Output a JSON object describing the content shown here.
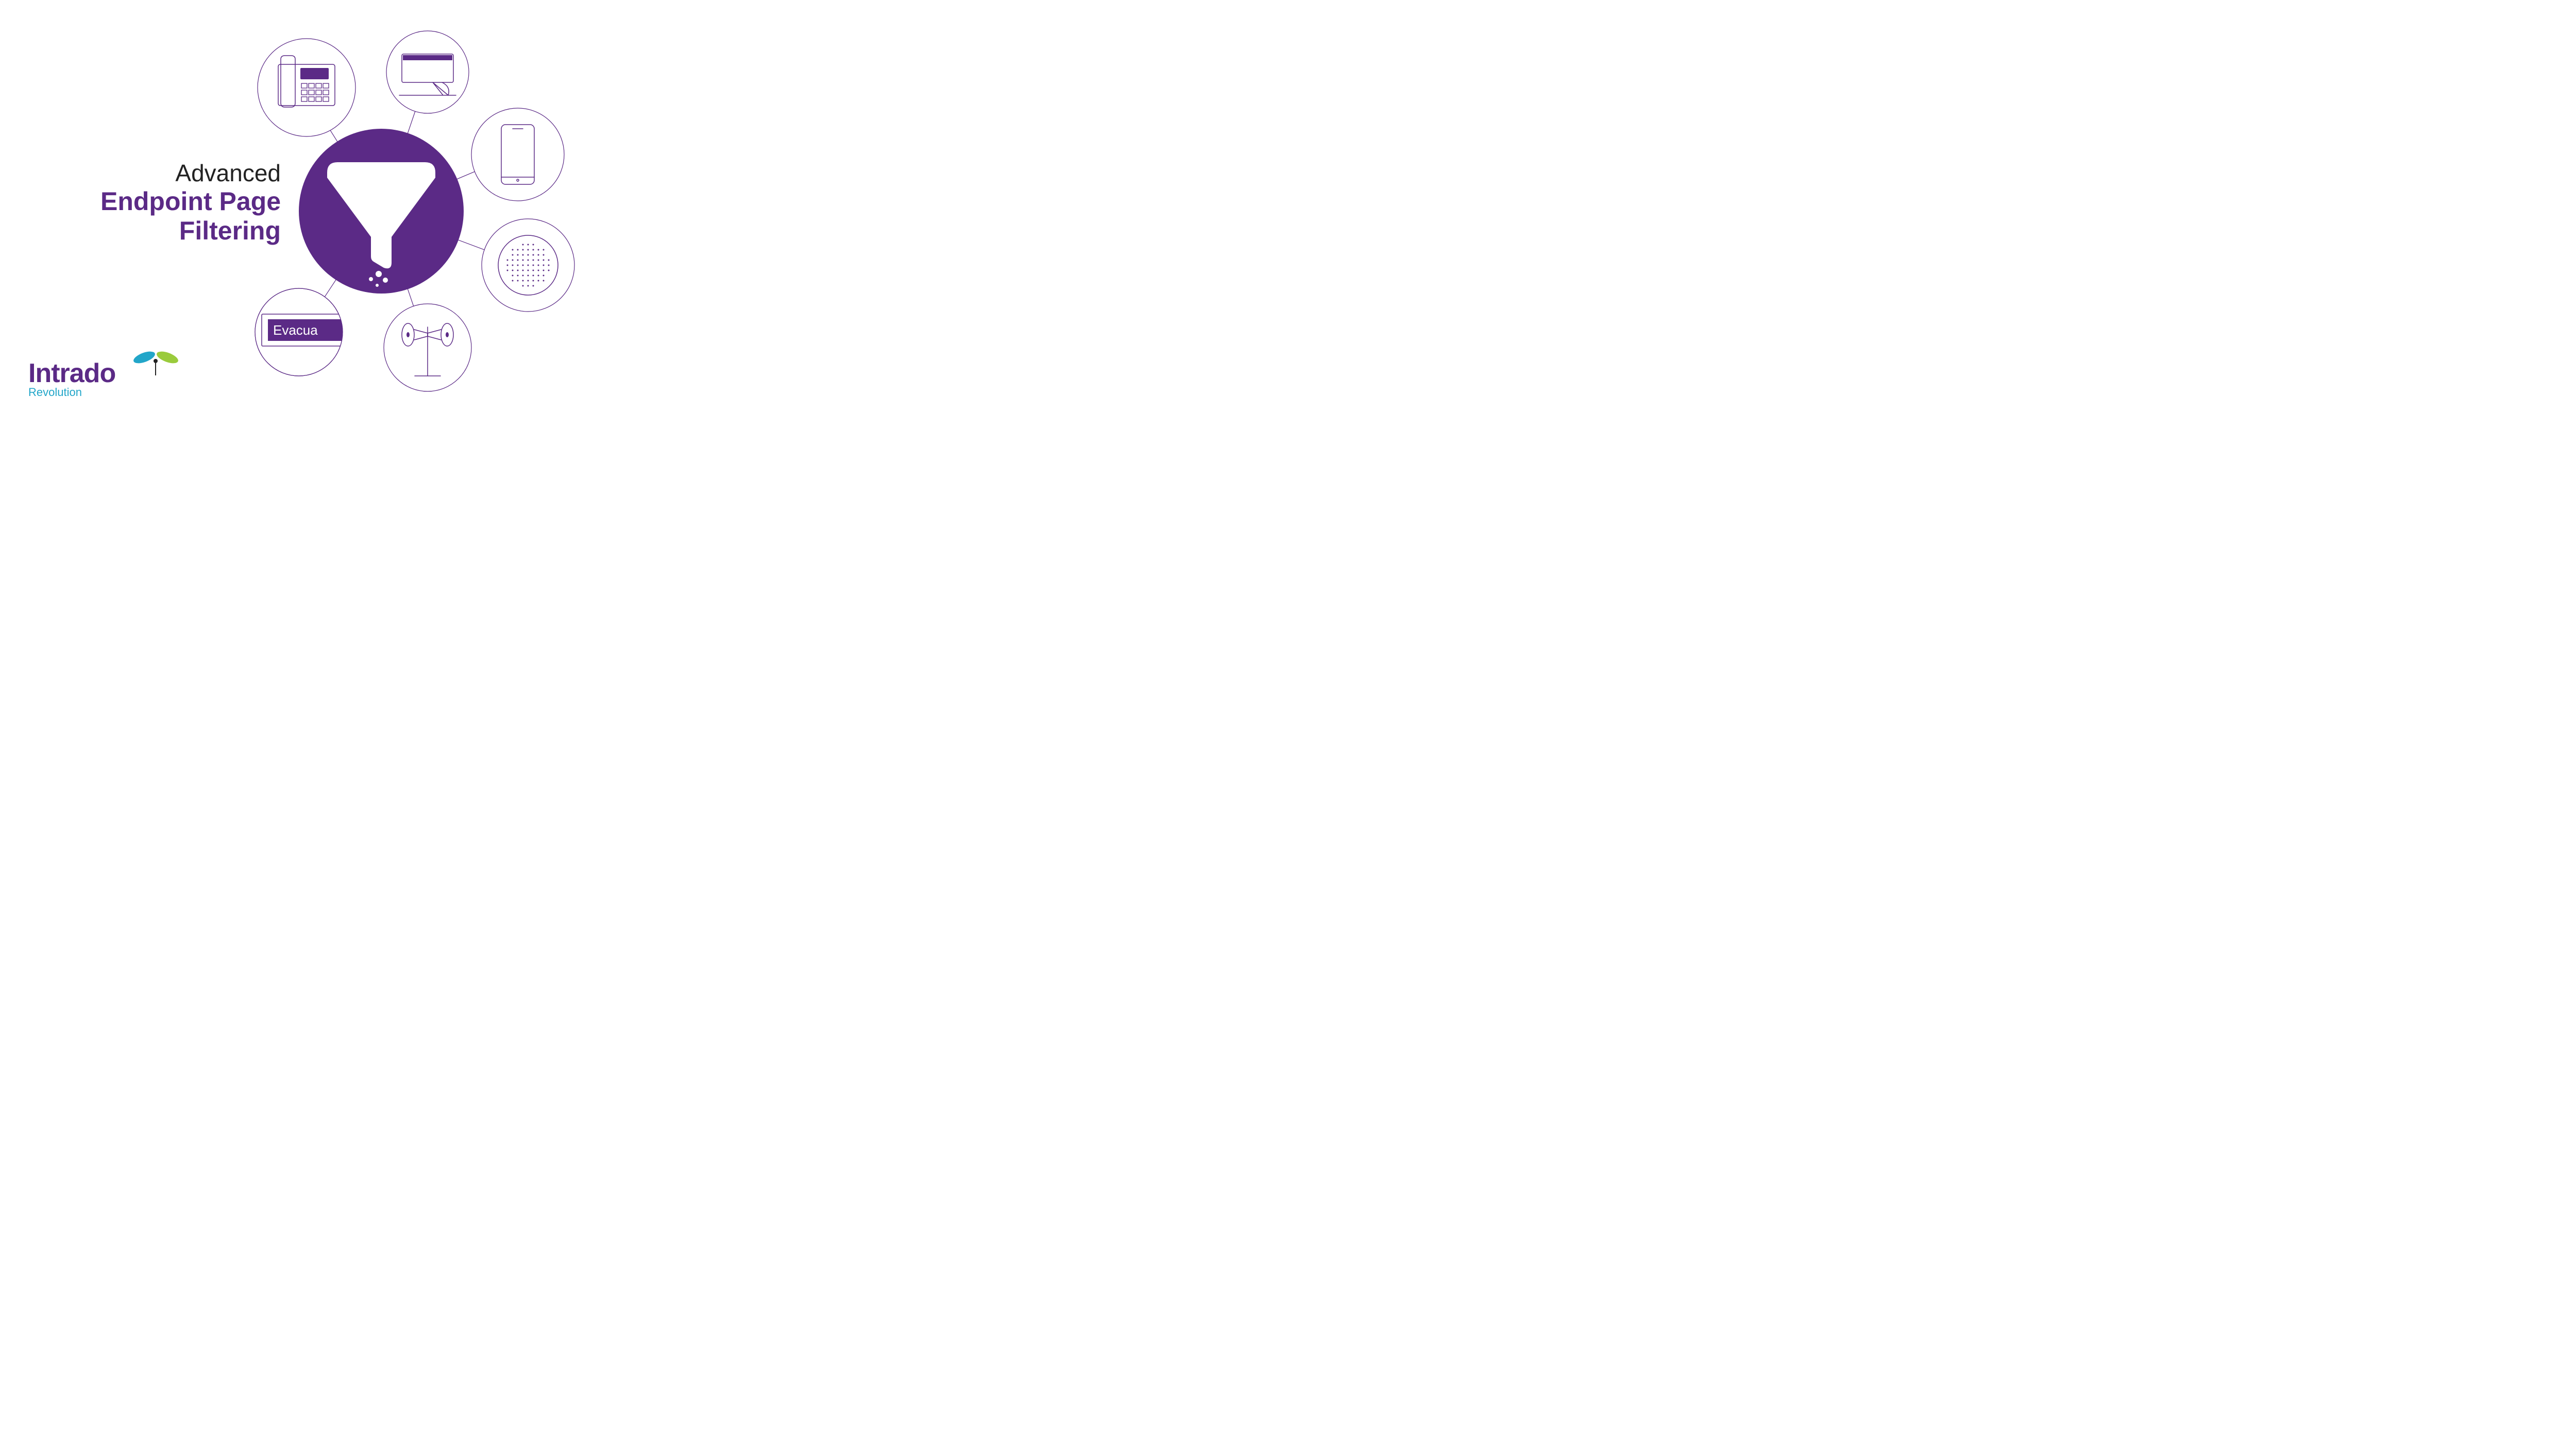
{
  "title": {
    "line1": "Advanced",
    "line2": "Endpoint Page",
    "line3": "Filtering"
  },
  "logo": {
    "brand": "Intrado",
    "product": "Revolution"
  },
  "colors": {
    "brandPurple": "#5b2a86",
    "accentTeal": "#22a6c9",
    "accentGreen": "#9acb3c"
  },
  "diagram": {
    "hub": {
      "icon": "funnel-icon",
      "label": "Filter"
    },
    "nodes": [
      {
        "name": "desk-phone-icon",
        "label": "Desk Phone"
      },
      {
        "name": "desktop-icon",
        "label": "Desktop Display"
      },
      {
        "name": "mobile-icon",
        "label": "Mobile Device"
      },
      {
        "name": "speaker-icon",
        "label": "Speaker"
      },
      {
        "name": "siren-icon",
        "label": "Outdoor Siren"
      },
      {
        "name": "signage-icon",
        "label": "Digital Signage",
        "text": "Evacua"
      }
    ]
  }
}
